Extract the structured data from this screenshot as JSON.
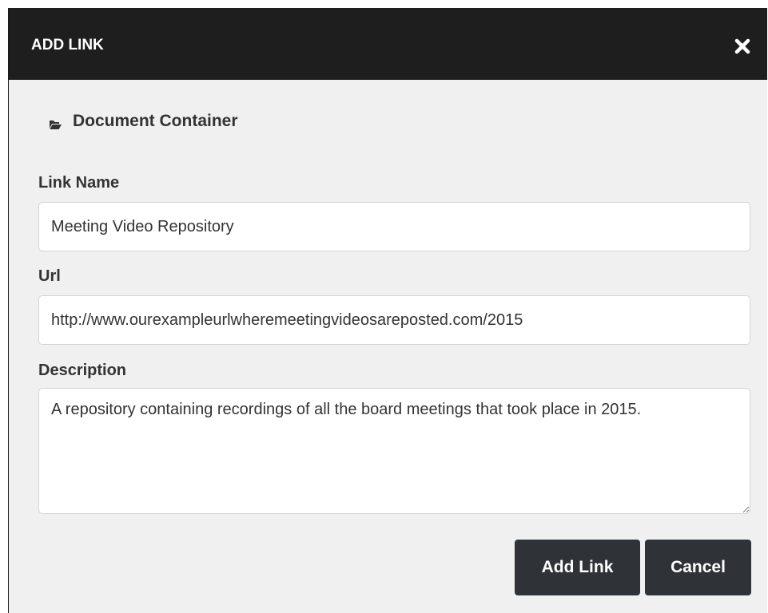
{
  "dialog": {
    "title": "ADD LINK",
    "close_icon": "close-icon"
  },
  "breadcrumb": {
    "icon": "folder-open-icon",
    "label": "Document Container"
  },
  "form": {
    "link_name_label": "Link Name",
    "link_name_value": "Meeting Video Repository",
    "url_label": "Url",
    "url_value": "http://www.ourexampleurlwheremeetingvideosareposted.com/2015",
    "description_label": "Description",
    "description_value": "A repository containing recordings of all the board meetings that took place in 2015."
  },
  "actions": {
    "add_label": "Add Link",
    "cancel_label": "Cancel"
  },
  "colors": {
    "header_bg": "#1e1e1e",
    "body_bg": "#f0f0f0",
    "button_bg": "#2f3338"
  }
}
